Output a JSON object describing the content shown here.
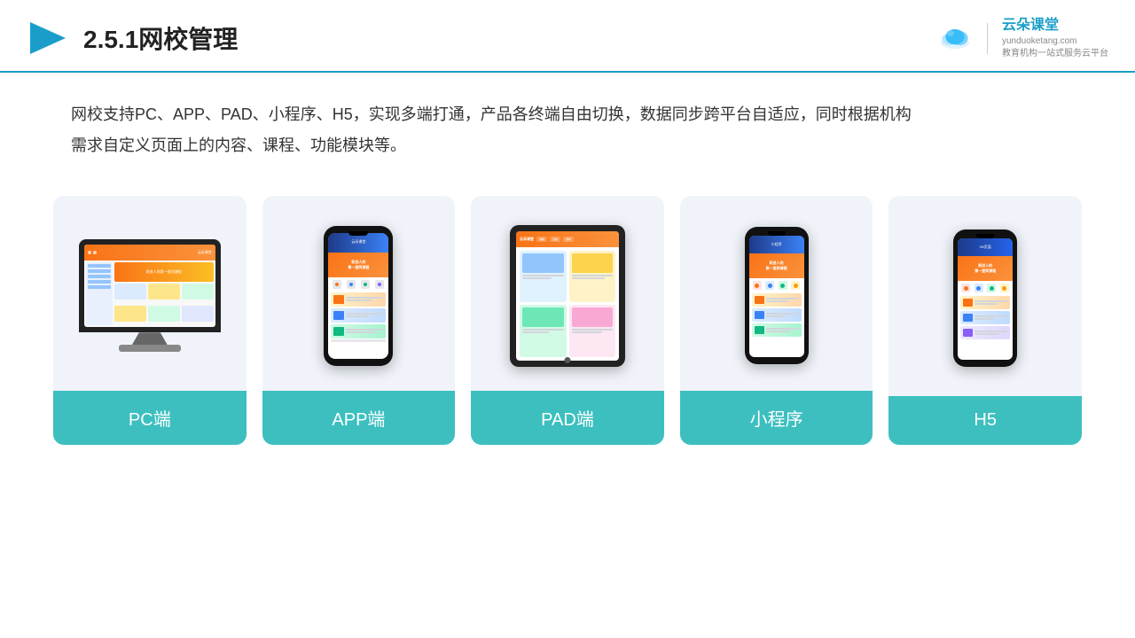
{
  "header": {
    "section_number": "2.5.1",
    "title": "网校管理",
    "brand_name": "云朵课堂",
    "brand_url": "yunduoketang.com",
    "brand_tagline": "教育机构一站式服务云平台"
  },
  "description": {
    "text_line1": "网校支持PC、APP、PAD、小程序、H5，实现多端打通，产品各终端自由切换，数据同步跨平台自适应，同时根据机构",
    "text_line2": "需求自定义页面上的内容、课程、功能模块等。"
  },
  "cards": [
    {
      "id": "pc",
      "label": "PC端"
    },
    {
      "id": "app",
      "label": "APP端"
    },
    {
      "id": "pad",
      "label": "PAD端"
    },
    {
      "id": "miniprogram",
      "label": "小程序"
    },
    {
      "id": "h5",
      "label": "H5"
    }
  ]
}
